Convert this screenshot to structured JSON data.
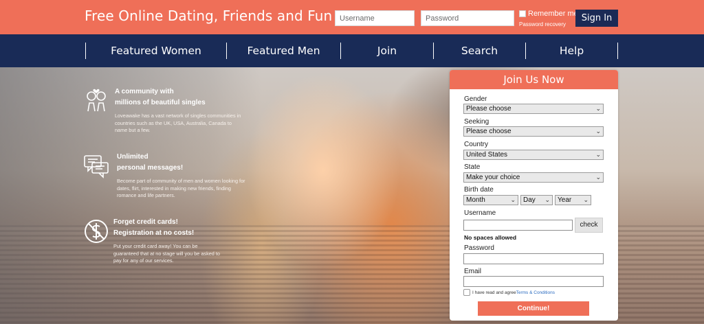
{
  "header": {
    "title": "Free Online Dating, Friends and Fun",
    "username_placeholder": "Username",
    "password_placeholder": "Password",
    "remember_label": "Remember me",
    "password_recovery": "Password recovery",
    "signin_label": "Sign In"
  },
  "nav": {
    "items": [
      {
        "label": "Featured Women"
      },
      {
        "label": "Featured Men"
      },
      {
        "label": "Join"
      },
      {
        "label": "Search"
      },
      {
        "label": "Help"
      }
    ]
  },
  "features": [
    {
      "icon": "couple-icon",
      "title_line1": "A community with",
      "title_line2": "millions of beautiful singles",
      "text": "Loveawake has a vast network of singles communities in countries such as the UK, USA, Australia, Canada to name but a few."
    },
    {
      "icon": "chat-bubbles-icon",
      "title_line1": "Unlimited",
      "title_line2": "personal messages!",
      "text": "Become part of community of men and women looking for dates, flirt, interested in making new friends, finding romance and life partners."
    },
    {
      "icon": "no-dollar-icon",
      "title_line1": "Forget credit cards!",
      "title_line2": "Registration at no costs!",
      "text": "Put your credit card away! You can be guaranteed that at no stage will you be asked to pay for any of our services."
    }
  ],
  "join": {
    "title": "Join Us Now",
    "gender_label": "Gender",
    "gender_value": "Please choose",
    "seeking_label": "Seeking",
    "seeking_value": "Please choose",
    "country_label": "Country",
    "country_value": "United States",
    "state_label": "State",
    "state_value": "Make your choice",
    "birth_label": "Birth date",
    "month_value": "Month",
    "day_value": "Day",
    "year_value": "Year",
    "username_label": "Username",
    "check_label": "check",
    "username_hint": "No spaces allowed",
    "password_label": "Password",
    "email_label": "Email",
    "terms_text": "I have read and agree",
    "terms_link": "Terms & Conditions",
    "continue_label": "Continue!"
  },
  "colors": {
    "accent": "#ef6f58",
    "navy": "#192b57",
    "button_navy": "#1b2a55"
  }
}
